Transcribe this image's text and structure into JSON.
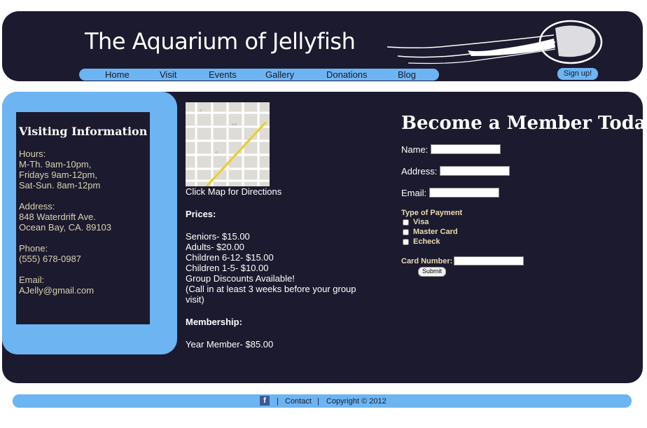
{
  "header": {
    "title": "The Aquarium of Jellyfish",
    "nav": [
      "Home",
      "Visit",
      "Events",
      "Gallery",
      "Donations",
      "Blog"
    ],
    "signup": "Sign up!"
  },
  "visiting": {
    "heading": "Visiting Information",
    "hours": [
      "Hours:",
      "M-Th. 9am-10pm,",
      "Fridays 9am-12pm,",
      "Sat-Sun. 8am-12pm"
    ],
    "address": [
      "Address:",
      "848 Waterdrift Ave.",
      "Ocean Bay, CA. 89103"
    ],
    "phone": [
      "Phone:",
      "(555) 678-0987"
    ],
    "email": [
      "Email:",
      "AJelly@gmail.com"
    ]
  },
  "middle": {
    "map_caption": "Click Map for Directions",
    "prices_heading": "Prices:",
    "prices": [
      "Seniors- $15.00",
      "Adults- $20.00",
      "Children 6-12- $15.00",
      "Children 1-5- $10.00",
      "Group Discounts Available!",
      "(Call in at least 3 weeks before your group visit)"
    ],
    "membership_heading": "Membership:",
    "membership": "Year Member- $85.00"
  },
  "form": {
    "title": "Become a Member Today!",
    "name_label": "Name:",
    "address_label": "Address:",
    "email_label": "Email:",
    "payment_heading": "Type of Payment",
    "payment_options": [
      "Visa",
      "Master Card",
      "Echeck"
    ],
    "card_label": "Card Number:",
    "submit": "Submit"
  },
  "footer": {
    "facebook": "f",
    "separator": "|",
    "contact": "Contact",
    "copyright": "Copyright © 2012"
  },
  "colors": {
    "background_dark": "#1c1a2e",
    "accent_blue": "#6db4f2",
    "text_cream": "#d8d3b0"
  }
}
